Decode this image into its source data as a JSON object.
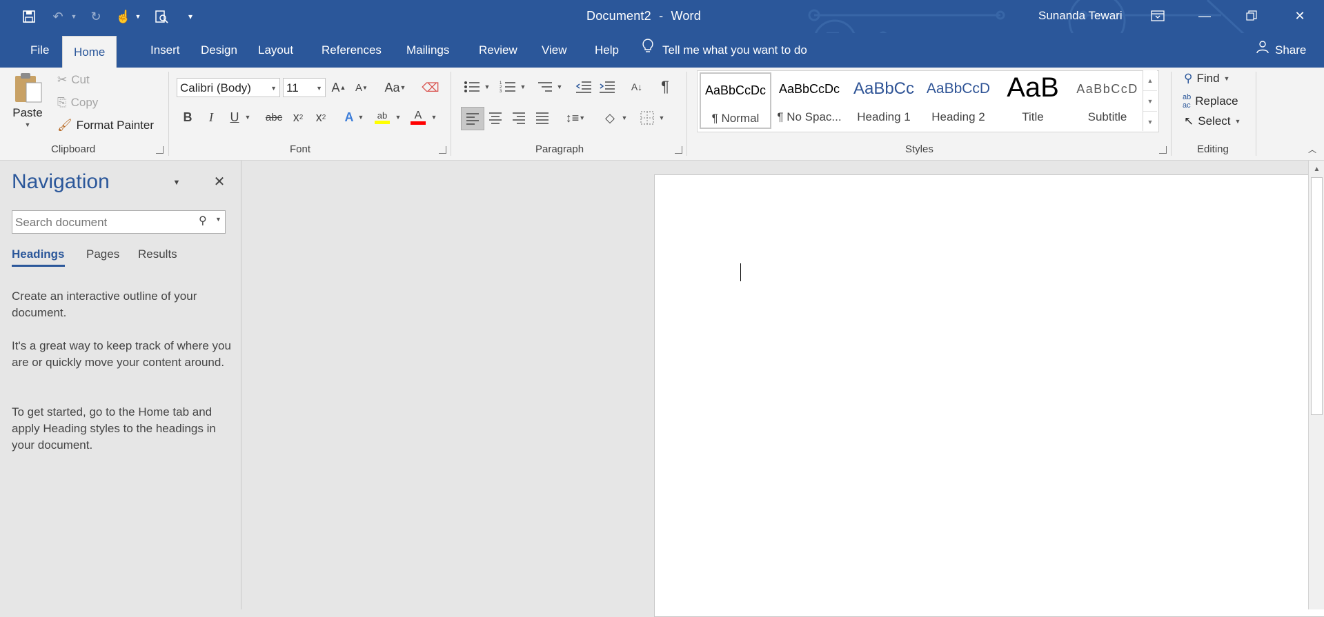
{
  "window": {
    "doc_title": "Document2",
    "separator": "-",
    "app_name": "Word",
    "user_name": "Sunanda Tewari"
  },
  "quick_access": {
    "icons": [
      "save-icon",
      "undo-icon",
      "redo-icon",
      "touch-mode-icon",
      "print-preview-icon",
      "customize-qat-icon"
    ]
  },
  "tabs": {
    "file": "File",
    "home": "Home",
    "insert": "Insert",
    "design": "Design",
    "layout": "Layout",
    "references": "References",
    "mailings": "Mailings",
    "review": "Review",
    "view": "View",
    "help": "Help",
    "tell_me": "Tell me what you want to do",
    "share": "Share"
  },
  "clipboard": {
    "paste": "Paste",
    "cut": "Cut",
    "copy": "Copy",
    "format_painter": "Format Painter",
    "label": "Clipboard"
  },
  "font": {
    "name": "Calibri (Body)",
    "size": "11",
    "label": "Font"
  },
  "paragraph": {
    "label": "Paragraph"
  },
  "styles": {
    "label": "Styles",
    "items": [
      {
        "preview": "AaBbCcDc",
        "name": "¶ Normal"
      },
      {
        "preview": "AaBbCcDc",
        "name": "¶ No Spac..."
      },
      {
        "preview": "AaBbCc",
        "name": "Heading 1"
      },
      {
        "preview": "AaBbCcD",
        "name": "Heading 2"
      },
      {
        "preview": "AaB",
        "name": "Title"
      },
      {
        "preview": "AaBbCcD",
        "name": "Subtitle"
      }
    ]
  },
  "editing": {
    "find": "Find",
    "replace": "Replace",
    "select": "Select",
    "label": "Editing"
  },
  "navigation": {
    "title": "Navigation",
    "search_placeholder": "Search document",
    "tabs": [
      "Headings",
      "Pages",
      "Results"
    ],
    "paragraphs": [
      "Create an interactive outline of your document.",
      "It's a great way to keep track of where you are or quickly move your content around.",
      "To get started, go to the Home tab and apply Heading styles to the headings in your document."
    ]
  },
  "colors": {
    "brand_blue": "#2b579a",
    "highlight_yellow": "#ffff00",
    "font_color_red": "#ff0000"
  }
}
